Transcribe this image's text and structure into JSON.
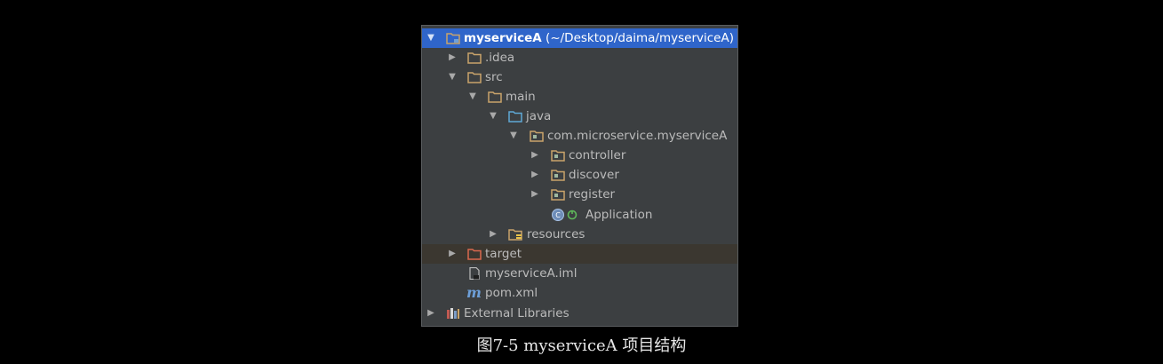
{
  "tree": {
    "root": {
      "name": "myserviceA",
      "path": "(~/Desktop/daima/myserviceA)"
    },
    "idea": ".idea",
    "src": "src",
    "main": "main",
    "java": "java",
    "package": "com.microservice.myserviceA",
    "controller": "controller",
    "discover": "discover",
    "register": "register",
    "application": "Application",
    "resources": "resources",
    "target": "target",
    "iml": "myserviceA.iml",
    "pom": "pom.xml",
    "external": "External Libraries"
  },
  "icons": {
    "folder": "folder-icon",
    "module": "module-folder-icon",
    "source_root": "source-root-icon",
    "package": "package-icon",
    "resources_root": "resources-root-icon",
    "excluded": "excluded-folder-icon",
    "file": "file-icon",
    "maven": "maven-icon",
    "library": "library-icon",
    "spring_boot": "spring-boot-class-icon"
  },
  "colors": {
    "selection": "#2f65ca",
    "panel": "#3c3f41",
    "folder": "#c9a46b",
    "source_root": "#5fa9d6",
    "excluded": "#d9684e"
  },
  "caption": "图7-5 myserviceA 项目结构"
}
